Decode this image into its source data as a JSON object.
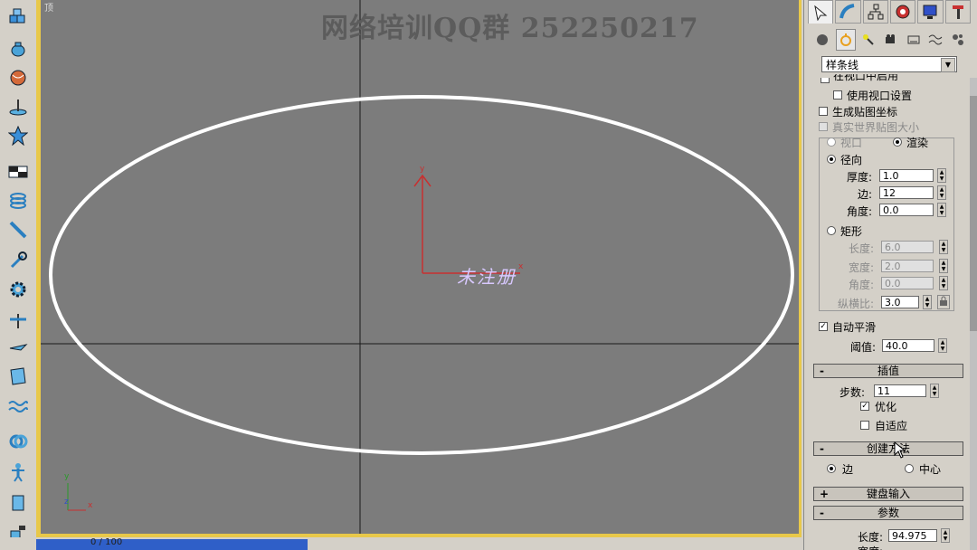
{
  "viewport": {
    "label": "顶",
    "watermark": "网络培训QQ群 252250217",
    "overlay_text": "未注册",
    "gizmo_y": "y",
    "gizmo_x": "x",
    "corner_y": "y",
    "corner_z": "z",
    "corner_x": "x"
  },
  "left_toolbar": {
    "icons": [
      "cube-icon",
      "teapot-icon",
      "sphere-icon",
      "lamp-icon",
      "star-icon",
      "grid-block-icon",
      "coil-icon",
      "brush-icon",
      "wrench-icon",
      "gear-icon",
      "fan-icon",
      "plane-icon",
      "cloth-icon",
      "wave-icon",
      "knot-icon",
      "figure-icon",
      "tool-icon",
      "tape-icon"
    ]
  },
  "command_panel": {
    "tabs": [
      "create-tab",
      "modify-tab",
      "hierarchy-tab",
      "motion-tab",
      "display-tab",
      "utilities-tab"
    ],
    "sub_icons": [
      "geometry",
      "shapes",
      "lights",
      "cameras",
      "helpers",
      "spacewarps",
      "systems"
    ],
    "category": "样条线",
    "render": {
      "partial_label": "在视口中启用",
      "use_viewport_settings": "使用视口设置",
      "gen_map_coords": "生成贴图坐标",
      "real_world_map": "真实世界贴图大小",
      "viewport_radio": "视口",
      "render_radio": "渲染",
      "radial": "径向",
      "thickness_label": "厚度:",
      "thickness_value": "1.0",
      "sides_label": "边:",
      "sides_value": "12",
      "angle_label": "角度:",
      "angle_value": "0.0",
      "rect": "矩形",
      "length_label": "长度:",
      "length_value": "6.0",
      "width_label": "宽度:",
      "width_value": "2.0",
      "angle2_label": "角度:",
      "angle2_value": "0.0",
      "aspect_label": "纵横比:",
      "aspect_value": "3.0",
      "auto_smooth": "自动平滑",
      "threshold_label": "阈值:",
      "threshold_value": "40.0"
    },
    "interpolation": {
      "title": "插值",
      "sign": "-",
      "steps_label": "步数:",
      "steps_value": "11",
      "optimize": "优化",
      "adaptive": "自适应"
    },
    "creation_method": {
      "title": "创建方法",
      "sign": "-",
      "edge": "边",
      "center": "中心"
    },
    "keyboard_entry": {
      "title": "键盘输入",
      "sign": "+"
    },
    "parameters": {
      "title": "参数",
      "sign": "-",
      "length_label": "长度:",
      "length_value": "94.975",
      "width_label": "宽度:"
    }
  },
  "taskbar": {
    "text": "0 / 100"
  }
}
